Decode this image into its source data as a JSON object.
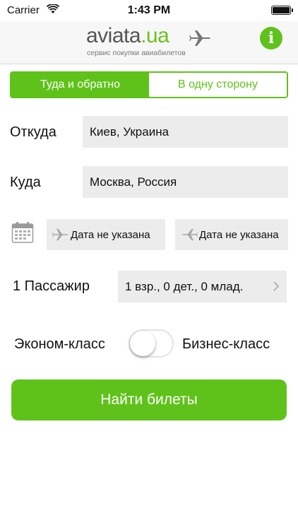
{
  "status_bar": {
    "carrier": "Carrier",
    "time": "1:43 PM"
  },
  "header": {
    "logo_brand": "aviata",
    "logo_tld": ".ua",
    "tagline": "сервис покупки авиабилетов",
    "info_label": "i"
  },
  "trip_type": {
    "round_trip": "Туда и обратно",
    "one_way": "В одну сторону",
    "selected": "round_trip"
  },
  "from": {
    "label": "Откуда",
    "value": "Киев, Украина"
  },
  "to": {
    "label": "Куда",
    "value": "Москва, Россия"
  },
  "dates": {
    "depart": "Дата не указана",
    "return": "Дата не указана"
  },
  "passengers": {
    "label": "1 Пассажир",
    "value": "1 взр., 0 дет., 0 млад."
  },
  "class": {
    "economy": "Эконом-класс",
    "business": "Бизнес-класс",
    "business_selected": false
  },
  "search_button": "Найти билеты",
  "colors": {
    "accent": "#5fc21a",
    "field_bg": "#ececec"
  }
}
